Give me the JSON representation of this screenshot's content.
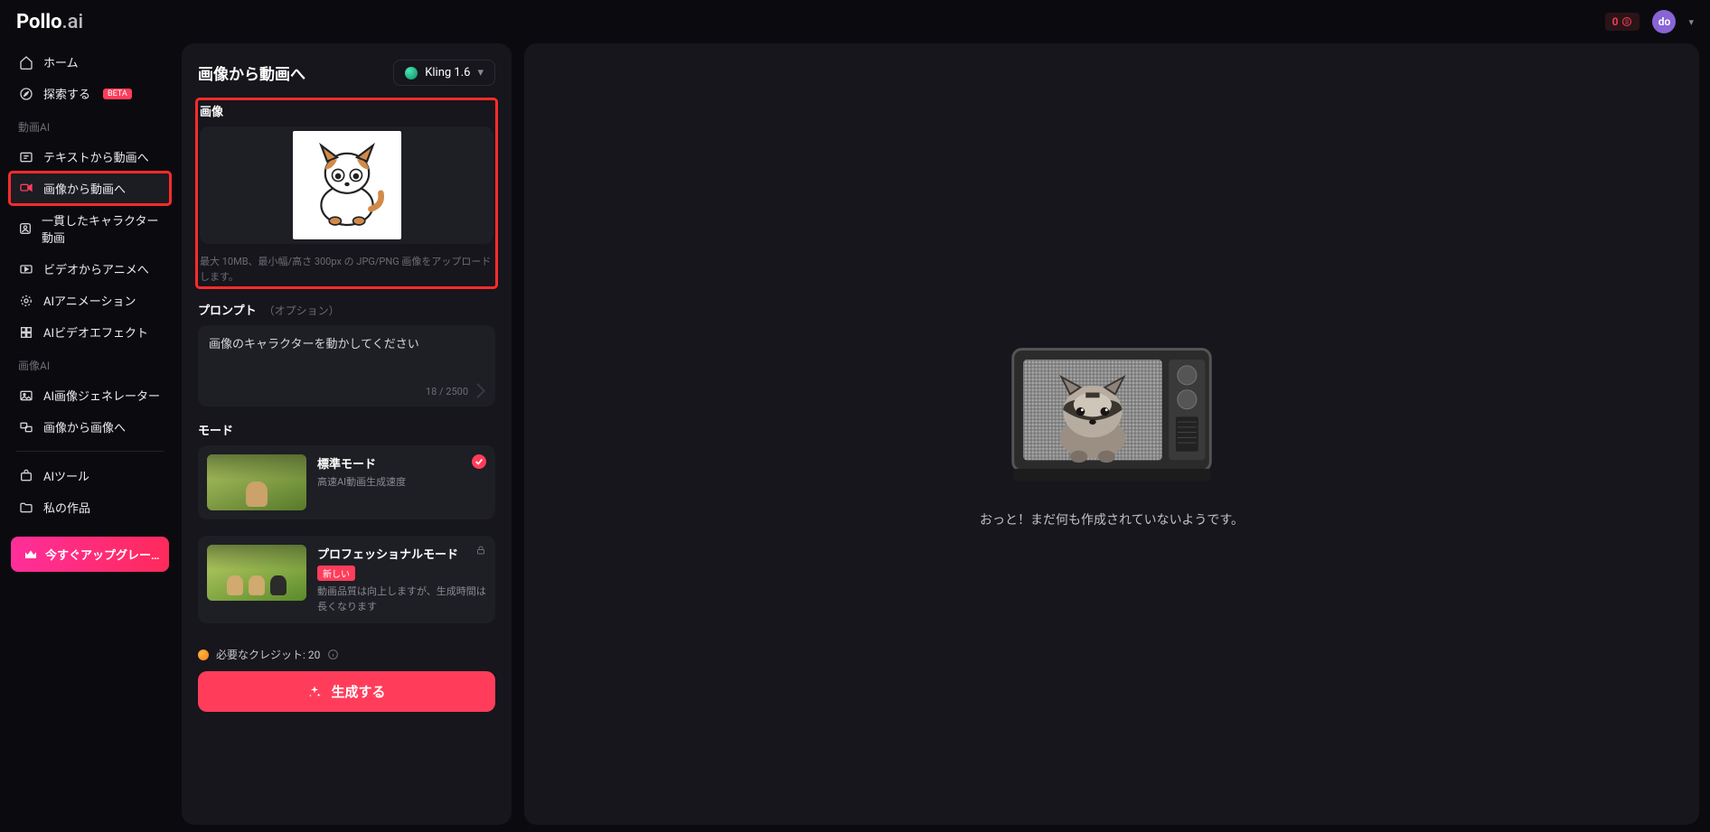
{
  "header": {
    "logo_main": "Pollo",
    "logo_sub": ".ai",
    "credit_badge": "0",
    "avatar_initials": "do"
  },
  "sidebar": {
    "home": "ホーム",
    "explore": "探索する",
    "explore_badge": "BETA",
    "group_video": "動画AI",
    "text_to_video": "テキストから動画へ",
    "image_to_video": "画像から動画へ",
    "consistent_character": "一貫したキャラクター動画",
    "video_to_anime": "ビデオからアニメへ",
    "ai_animation": "AIアニメーション",
    "ai_video_effects": "AIビデオエフェクト",
    "group_image": "画像AI",
    "ai_image_generator": "AI画像ジェネレーター",
    "image_to_image": "画像から画像へ",
    "ai_tools": "AIツール",
    "my_works": "私の作品",
    "upgrade": "今すぐアップグレー…"
  },
  "panel": {
    "title": "画像から動画へ",
    "model": "Kling 1.6",
    "image_label": "画像",
    "upload_hint": "最大 10MB、最小幅/高さ 300px の JPG/PNG 画像をアップロードします。",
    "prompt_label": "プロンプト",
    "prompt_optional": "（オプション）",
    "prompt_value": "画像のキャラクターを動かしてください",
    "prompt_counter": "18 / 2500",
    "mode_label": "モード",
    "mode_standard_title": "標準モード",
    "mode_standard_desc": "高速AI動画生成速度",
    "mode_pro_title": "プロフェッショナルモード",
    "mode_pro_new": "新しい",
    "mode_pro_desc": "動画品質は向上しますが、生成時間は長くなります",
    "credits_label": "必要なクレジット: 20",
    "generate": "生成する"
  },
  "preview": {
    "empty": "おっと！まだ何も作成されていないようです。"
  }
}
